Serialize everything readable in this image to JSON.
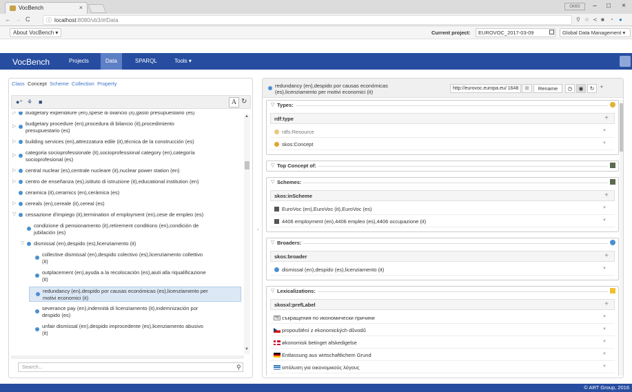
{
  "browser": {
    "tab_title": "VocBench",
    "tab_close": "×",
    "url_host": "localhost",
    "url_rest": ":8080/vb3/#/Data",
    "window_label": "OMIS",
    "window_min": "–",
    "window_max": "□",
    "window_close": "×"
  },
  "appbar": {
    "about_label": "About VocBench ▾",
    "current_project_label": "Current project:",
    "current_project_value": "EUROVOC_2017-03-09",
    "global_btn": "Global Data Management ▾"
  },
  "navbar": {
    "brand": "VocBench",
    "items": [
      "Projects",
      "Data",
      "SPARQL",
      "Tools ▾"
    ],
    "active": "Data"
  },
  "left": {
    "tabs": [
      "Class",
      "Concept",
      "Scheme",
      "Collection",
      "Property"
    ],
    "active_tab": "Concept",
    "btn_a": "A",
    "search_placeholder": "Search...",
    "tree": [
      {
        "label": "budgetary expenditure (en),spese di bilancio (it),gasto presupuestario (es)",
        "indent": 0,
        "arrow": "▷"
      },
      {
        "label": "budgetary procedure (en),procedura di bilancio (it),procedimiento",
        "label2": "presupuestario (es)",
        "indent": 0,
        "arrow": "▷"
      },
      {
        "label": "building services (en),attrezzatura edile (it),técnica de la construcción (es)",
        "indent": 0,
        "arrow": "▷"
      },
      {
        "label": "categoria socioprofessionale (it),socioprofessional category (en),categoría",
        "label2": "socioprofesional (es)",
        "indent": 0,
        "arrow": "▷"
      },
      {
        "label": "central nuclear (es),centrale nucleare (it),nuclear power station (en)",
        "indent": 0,
        "arrow": "▷"
      },
      {
        "label": "centro de enseñanza (es),istituto di istruzione (it),educational institution (en)",
        "indent": 0,
        "arrow": "▷"
      },
      {
        "label": "ceramica (it),ceramics (en),cerámica (es)",
        "indent": 0,
        "arrow": ""
      },
      {
        "label": "cereals (en),cereale (it),cereal (es)",
        "indent": 0,
        "arrow": "▷"
      },
      {
        "label": "cessazione d'impiego (it),termination of employment (en),cese de empleo (es)",
        "indent": 0,
        "arrow": "▽"
      },
      {
        "label": "condizione di pensionamento (it),retirement conditions (en),condición de",
        "label2": "jubilación (es)",
        "indent": 1,
        "arrow": ""
      },
      {
        "label": "dismissal (en),despido (es),licenziamento (it)",
        "indent": 1,
        "arrow": "▽"
      },
      {
        "label": "collective dismissal (en),despido colectivo (es),licenziamento collettivo",
        "label2": "(it)",
        "indent": 2,
        "arrow": ""
      },
      {
        "label": "outplacement (en),ayuda a la recolocación (es),aiuti alla riqualificazione",
        "label2": "(it)",
        "indent": 2,
        "arrow": ""
      },
      {
        "label": "redundancy (en),despido por causas económicas (es),licenziamento per",
        "label2": "motivi economici (it)",
        "indent": 2,
        "arrow": "",
        "selected": true
      },
      {
        "label": "severance pay (en),indennità di licenziamento (it),indemnización por",
        "label2": "despido (es)",
        "indent": 2,
        "arrow": ""
      },
      {
        "label": "unfair dismissal (en),despido improcedente (es),licenziamento abusivo",
        "label2": "(it)",
        "indent": 2,
        "arrow": ""
      }
    ]
  },
  "right": {
    "title_line1": "redundancy (en),despido por causas económicas",
    "title_line2": "(es),licenziamento per motivi economici (it)",
    "uri": "http://eurovoc.europa.eu/ 1648",
    "rename_label": "Rename",
    "sections": {
      "types": {
        "title": "Types:",
        "prop": "rdf:type",
        "values": [
          "rdfs:Resource",
          "skos:Concept"
        ]
      },
      "top_concept": {
        "title": "Top Concept of:"
      },
      "schemes": {
        "title": "Schemes:",
        "prop": "skos:inScheme",
        "values": [
          "EuroVoc (en),EuroVoc (it),EuroVoc (es)",
          "4406 employment (en),4406 empleo (es),4406 occupazione (it)"
        ]
      },
      "broaders": {
        "title": "Broaders:",
        "prop": "skos:broader",
        "values": [
          "dismissal (en),despido (es),licenziamento (it)"
        ]
      },
      "lexicalizations": {
        "title": "Lexicalizations:",
        "prop": "skosxl:prefLabel",
        "values": [
          {
            "flag": "bg",
            "flag_text": "bg",
            "text": "съкращения по икономически причини"
          },
          {
            "flag": "cz",
            "text": "propouštění z ekonomických důvodů"
          },
          {
            "flag": "dk",
            "text": "økonomisk betinget afskedigelse"
          },
          {
            "flag": "de",
            "text": "Entlassung aus wirtschaftlichem Grund"
          },
          {
            "flag": "gr",
            "text": "απόλυση για οικονομικούς λόγους"
          }
        ]
      }
    }
  },
  "footer": {
    "text": "© ART Group, 2016"
  }
}
